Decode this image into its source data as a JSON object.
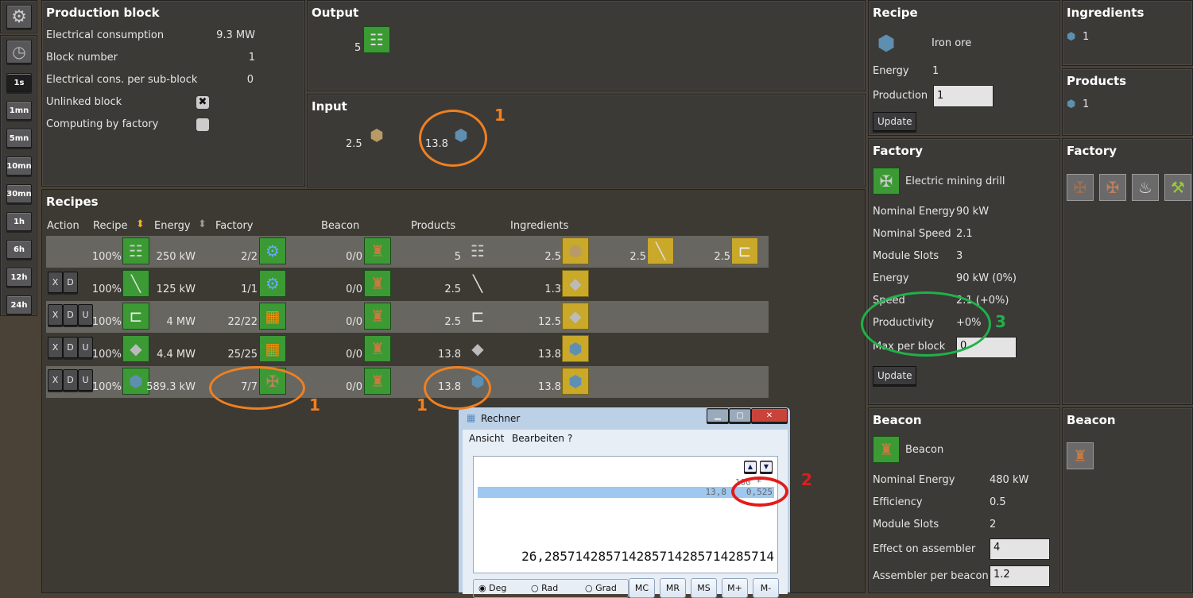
{
  "sidebar": {
    "time_buttons": [
      "1s",
      "1mn",
      "5mn",
      "10mn",
      "30mn",
      "1h",
      "6h",
      "12h",
      "24h"
    ],
    "active": "1s"
  },
  "production_block": {
    "title": "Production block",
    "rows": [
      {
        "label": "Electrical consumption",
        "value": "9.3 MW"
      },
      {
        "label": "Block number",
        "value": "1"
      },
      {
        "label": "Electrical cons. per sub-block",
        "value": "0"
      }
    ],
    "unlinked_label": "Unlinked block",
    "unlinked_checked": true,
    "computing_label": "Computing by factory",
    "computing_checked": false
  },
  "output": {
    "title": "Output",
    "items": [
      {
        "icon": "rail-icon",
        "value": "5"
      }
    ]
  },
  "input": {
    "title": "Input",
    "items": [
      {
        "icon": "stone-icon",
        "value": "2.5"
      },
      {
        "icon": "iron-ore-icon",
        "value": "13.8"
      }
    ]
  },
  "recipes": {
    "title": "Recipes",
    "headers": {
      "action": "Action",
      "recipe": "Recipe",
      "energy": "Energy",
      "factory": "Factory",
      "beacon": "Beacon",
      "products": "Products",
      "ingredients": "Ingredients"
    },
    "rows": [
      {
        "actions": [],
        "recipe": "rail",
        "pct": "100%",
        "energy": "250 kW",
        "factory_count": "2/2",
        "factory": "assembler",
        "beacon_count": "0/0",
        "products": [
          {
            "item": "rail",
            "v": "5"
          }
        ],
        "ingredients": [
          {
            "item": "stone",
            "v": "2.5"
          },
          {
            "item": "iron-stick",
            "v": "2.5"
          },
          {
            "item": "steel-plate",
            "v": "2.5"
          }
        ]
      },
      {
        "actions": [
          "X",
          "D"
        ],
        "recipe": "iron-stick",
        "pct": "100%",
        "energy": "125 kW",
        "factory_count": "1/1",
        "factory": "assembler",
        "beacon_count": "0/0",
        "products": [
          {
            "item": "iron-stick",
            "v": "2.5"
          }
        ],
        "ingredients": [
          {
            "item": "iron-plate",
            "v": "1.3"
          }
        ]
      },
      {
        "actions": [
          "X",
          "D",
          "U"
        ],
        "recipe": "steel-plate",
        "pct": "100%",
        "energy": "4 MW",
        "factory_count": "22/22",
        "factory": "furnace",
        "beacon_count": "0/0",
        "products": [
          {
            "item": "steel-plate",
            "v": "2.5"
          }
        ],
        "ingredients": [
          {
            "item": "iron-plate",
            "v": "12.5"
          }
        ]
      },
      {
        "actions": [
          "X",
          "D",
          "U"
        ],
        "recipe": "iron-plate",
        "pct": "100%",
        "energy": "4.4 MW",
        "factory_count": "25/25",
        "factory": "furnace",
        "beacon_count": "0/0",
        "products": [
          {
            "item": "iron-plate",
            "v": "13.8"
          }
        ],
        "ingredients": [
          {
            "item": "iron-ore",
            "v": "13.8"
          }
        ]
      },
      {
        "actions": [
          "X",
          "D",
          "U"
        ],
        "recipe": "iron-ore",
        "pct": "100%",
        "energy": "589.3 kW",
        "factory_count": "7/7",
        "factory": "drill",
        "beacon_count": "0/0",
        "products": [
          {
            "item": "iron-ore",
            "v": "13.8"
          }
        ],
        "ingredients": [
          {
            "item": "iron-ore",
            "v": "13.8"
          }
        ]
      }
    ]
  },
  "recipe_panel": {
    "title": "Recipe",
    "name": "Iron ore",
    "energy_label": "Energy",
    "energy": "1",
    "production_label": "Production",
    "production": "1",
    "update": "Update"
  },
  "ingredients_panel": {
    "title": "Ingredients",
    "value": "1"
  },
  "products_panel": {
    "title": "Products",
    "value": "1"
  },
  "factory_panel": {
    "title": "Factory",
    "name": "Electric mining drill",
    "rows": [
      {
        "label": "Nominal Energy",
        "value": "90 kW"
      },
      {
        "label": "Nominal Speed",
        "value": "2.1"
      },
      {
        "label": "Module Slots",
        "value": "3"
      },
      {
        "label": "Energy",
        "value": "90 kW (0%)"
      },
      {
        "label": "Speed",
        "value": "2.1 (+0%)"
      },
      {
        "label": "Productivity",
        "value": "+0%"
      }
    ],
    "max_label": "Max per block",
    "max_value": "0",
    "update": "Update"
  },
  "factory_list": {
    "title": "Factory"
  },
  "beacon_panel": {
    "title": "Beacon",
    "name": "Beacon",
    "rows": [
      {
        "label": "Nominal Energy",
        "value": "480 kW"
      },
      {
        "label": "Efficiency",
        "value": "0.5"
      },
      {
        "label": "Module Slots",
        "value": "2"
      }
    ],
    "effect_label": "Effect on assembler",
    "effect_value": "4",
    "per_label": "Assembler per beacon",
    "per_value": "1.2"
  },
  "beacon_list": {
    "title": "Beacon"
  },
  "calculator": {
    "title": "Rechner",
    "menu": [
      "Ansicht",
      "Bearbeiten",
      "?"
    ],
    "history1": "100 *",
    "history2a": "13,8",
    "history2b": "0,525",
    "display": "26,285714285714285714285714285714",
    "angle": [
      "Deg",
      "Rad",
      "Grad"
    ],
    "angle_selected": "Deg",
    "mem": [
      "MC",
      "MR",
      "MS",
      "M+",
      "M-"
    ]
  },
  "annotations": {
    "orange": "1",
    "red": "2",
    "green": "3",
    "orange_color": "#f08020",
    "red_color": "#e41b1b",
    "green_color": "#1fb14a"
  }
}
